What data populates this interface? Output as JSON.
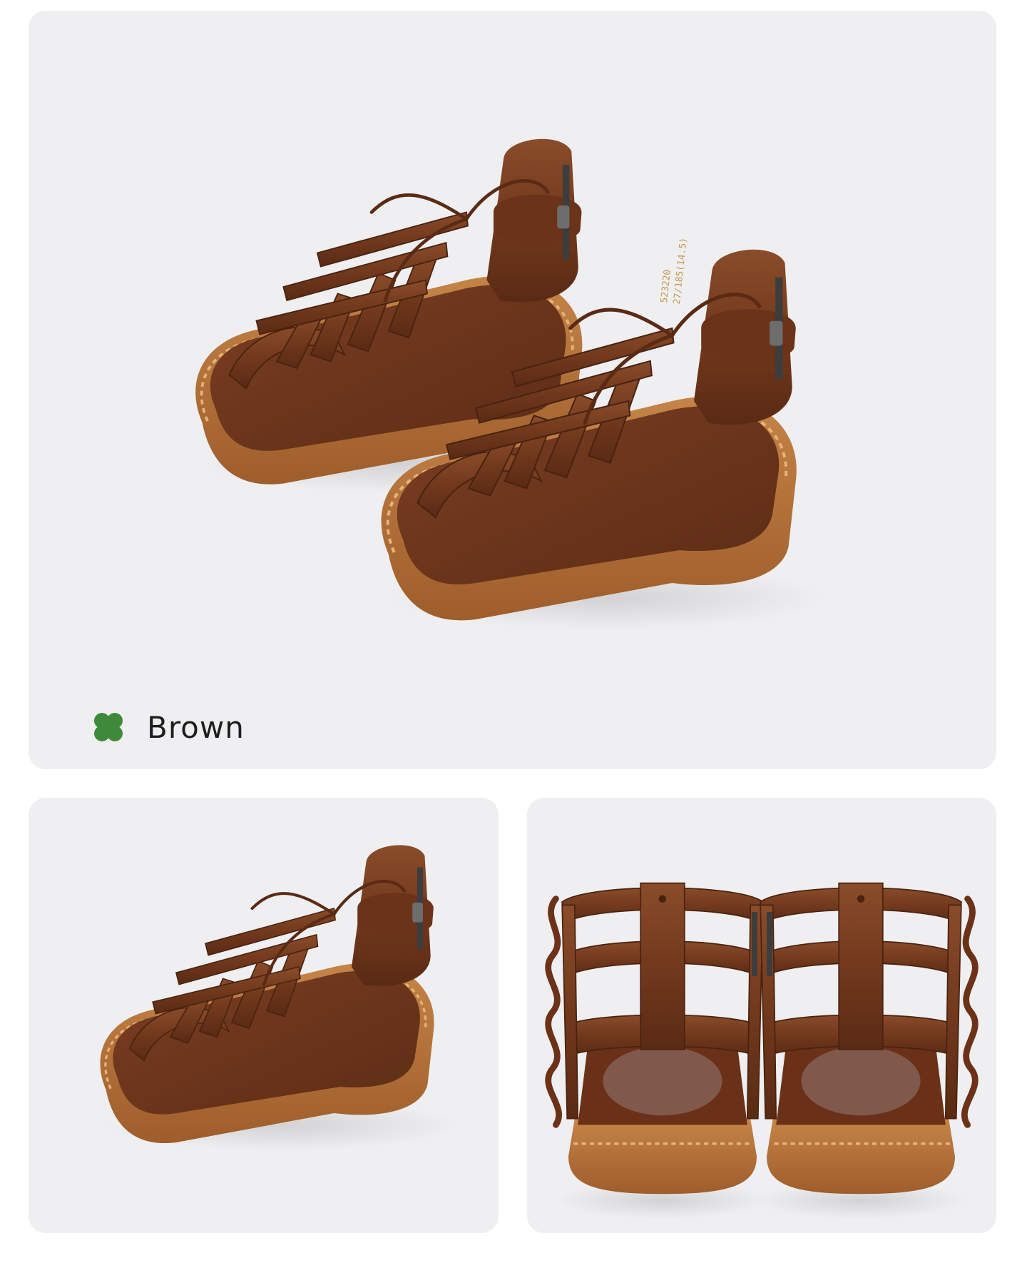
{
  "colorway": {
    "name": "Brown",
    "icon": "clover-icon",
    "icon_color": "#3f8a3a"
  },
  "photos": [
    {
      "view": "pair-angled"
    },
    {
      "view": "single-side"
    },
    {
      "view": "pair-rear"
    }
  ],
  "shoe_label": {
    "line1": "523220",
    "line2": "27/185(14.5)"
  },
  "colors": {
    "panel_bg": "#efeff1",
    "leather": "#7a3f22",
    "sole": "#b06d37"
  }
}
